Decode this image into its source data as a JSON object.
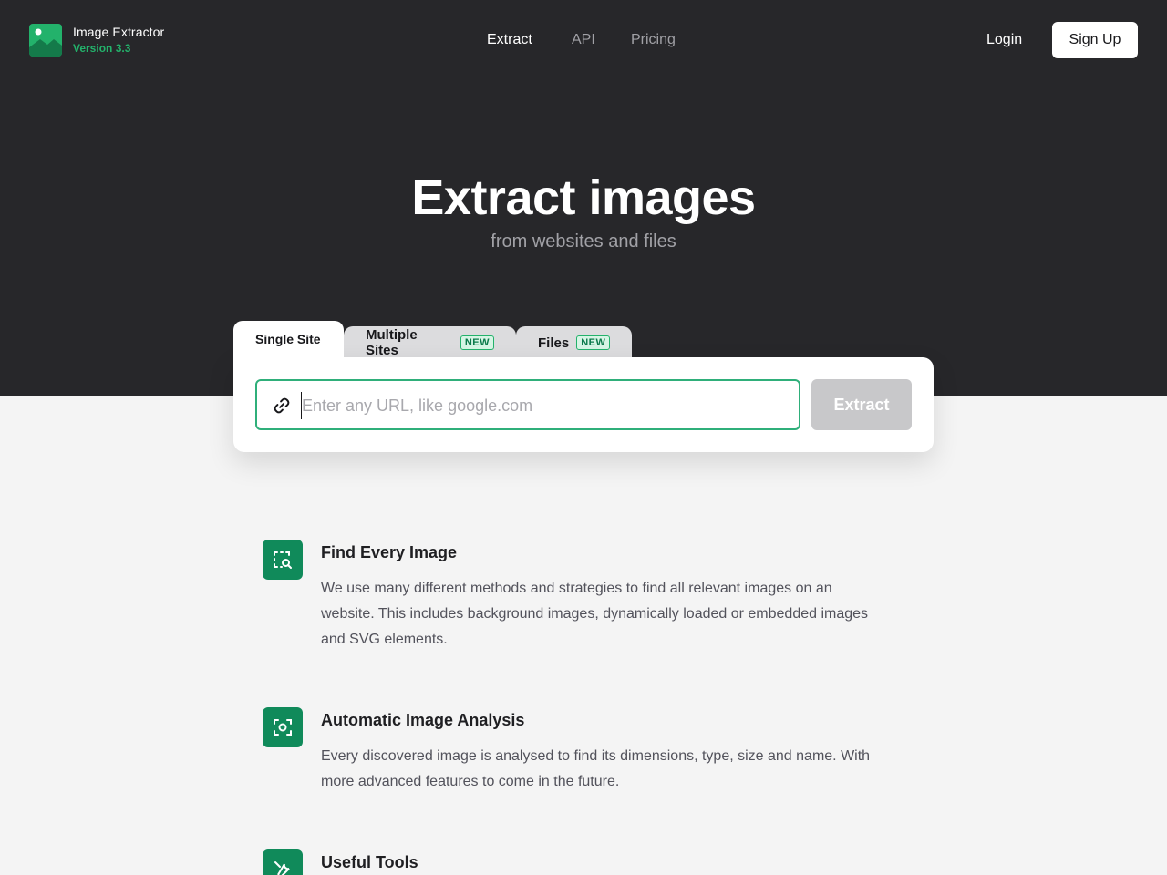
{
  "brand": {
    "name": "Image Extractor",
    "version": "Version 3.3"
  },
  "nav": {
    "items": [
      "Extract",
      "API",
      "Pricing"
    ],
    "login": "Login",
    "signup": "Sign Up"
  },
  "hero": {
    "title": "Extract images",
    "subtitle": "from websites and files"
  },
  "tabs": [
    {
      "label": "Single Site"
    },
    {
      "label": "Multiple Sites",
      "badge": "NEW"
    },
    {
      "label": "Files",
      "badge": "NEW"
    }
  ],
  "search": {
    "placeholder": "Enter any URL, like google.com",
    "value": "",
    "button": "Extract"
  },
  "features": [
    {
      "icon": "image-search-icon",
      "title": "Find Every Image",
      "description": "We use many different methods and strategies to find all relevant images on an website. This includes background images, dynamically loaded or embedded images and SVG elements."
    },
    {
      "icon": "image-scan-icon",
      "title": "Automatic Image Analysis",
      "description": "Every discovered image is analysed to find its dimensions, type, size and name. With more advanced features to come in the future."
    },
    {
      "icon": "wrench-icon",
      "title": "Useful Tools",
      "description": ""
    }
  ],
  "colors": {
    "hero_bg": "#27272a",
    "accent": "#108a5a",
    "version": "#23b26b",
    "page_bg": "#f4f4f4"
  }
}
